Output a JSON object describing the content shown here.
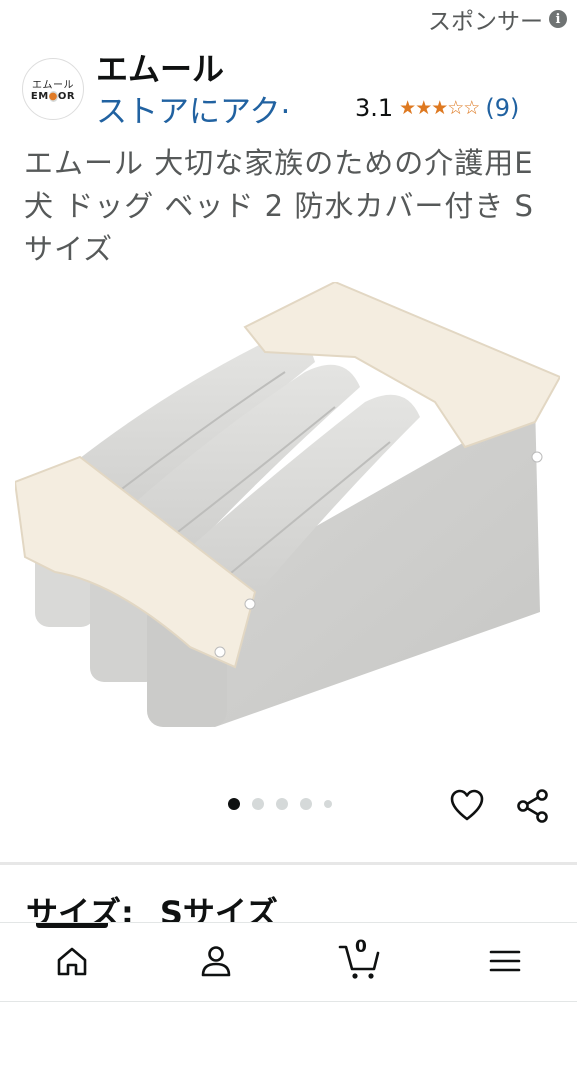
{
  "sponsored": {
    "label": "スポンサー",
    "info_icon": "i"
  },
  "brand": {
    "logo_line1": "エムール",
    "logo_line2_a": "EM",
    "logo_line2_dot": "●",
    "logo_line2_b": "OR",
    "name": "エムール",
    "store_link": "ストアにアク·"
  },
  "rating": {
    "value": "3.1",
    "stars_filled": 3,
    "stars_total": 5,
    "stars_text": "★★★☆☆",
    "count": "(9)"
  },
  "product": {
    "title": "エムール 大切な家族のための介護用E 犬 ドッグ ベッド 2 防水カバー付き Sサイズ"
  },
  "carousel": {
    "total": 5,
    "active_index": 0
  },
  "size": {
    "label": "サイズ:",
    "value": "Sサイズ"
  },
  "navbar": {
    "items": [
      "home-icon",
      "account-icon",
      "cart-icon",
      "menu-icon"
    ],
    "cart_count": "0",
    "active": "home"
  },
  "colors": {
    "link": "#2162a1",
    "star": "#de7921",
    "text": "#0f1111",
    "muted": "#565959"
  }
}
